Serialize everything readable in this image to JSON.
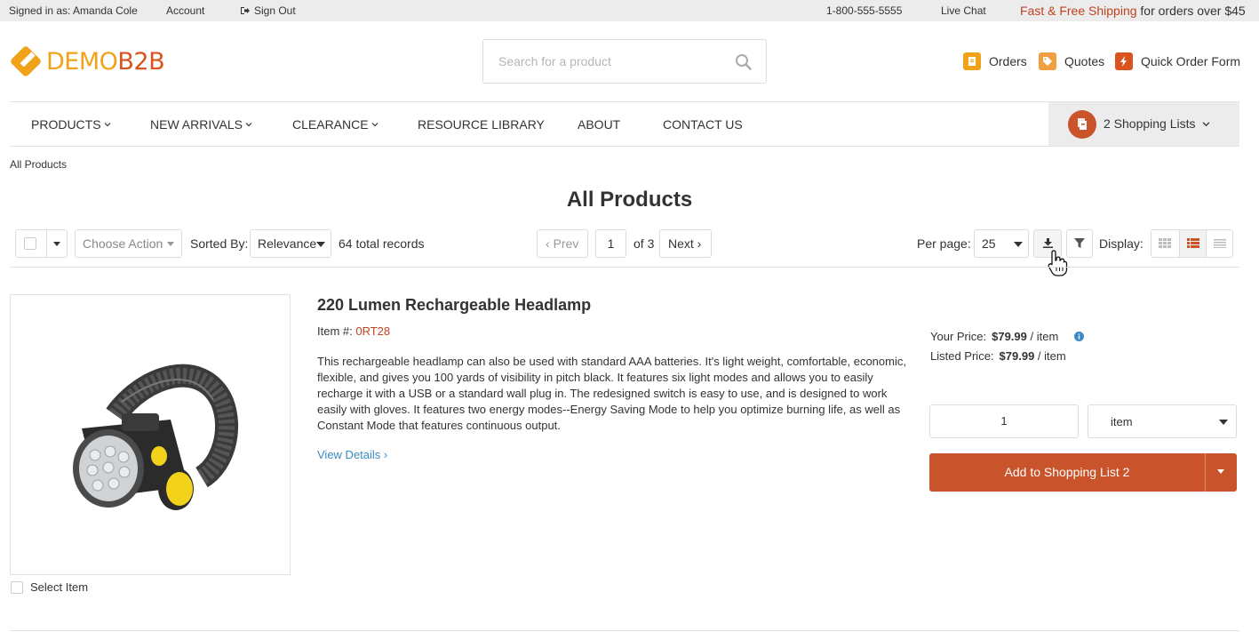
{
  "topbar": {
    "signed_in": "Signed in as: Amanda Cole",
    "account": "Account",
    "sign_out": "Sign Out",
    "phone": "1-800-555-5555",
    "live_chat": "Live Chat",
    "promo_highlight": "Fast & Free Shipping",
    "promo_rest": " for orders over $45"
  },
  "header": {
    "logo_text_1": "DEMO",
    "logo_text_2": "B2B",
    "search_placeholder": "Search for a product",
    "orders": "Orders",
    "quotes": "Quotes",
    "quick_order": "Quick Order Form"
  },
  "nav": {
    "items": [
      "PRODUCTS",
      "NEW ARRIVALS",
      "CLEARANCE",
      "RESOURCE LIBRARY",
      "ABOUT",
      "CONTACT US"
    ],
    "shopping_lists": "2 Shopping Lists",
    "shopping_lists_count": "2"
  },
  "breadcrumb": "All Products",
  "page_title": "All Products",
  "toolbar": {
    "choose_action": "Choose Action",
    "sorted_by_label": "Sorted By:",
    "sort_value": "Relevance",
    "total_records": "64 total records",
    "prev": "Prev",
    "page": "1",
    "of_pages": "of 3",
    "next": "Next",
    "per_page_label": "Per page:",
    "per_page_value": "25",
    "display_label": "Display:"
  },
  "product": {
    "title": "220 Lumen Rechargeable Headlamp",
    "item_label": "Item #: ",
    "item_code": "0RT28",
    "description": "This rechargeable headlamp can also be used with standard AAA batteries. It's light weight, comfortable, economic, flexible, and gives you 100 yards of visibility in pitch black. It features six light modes and allows you to easily recharge it with a USB or a standard wall plug in. The redesigned switch is easy to use, and is designed to work easily with gloves. It features two energy modes--Energy Saving Mode to help you optimize burning life, as well as Constant Mode that features continuous output.",
    "view_details": "View Details",
    "your_price_label": "Your Price:",
    "your_price": "$79.99",
    "listed_price_label": "Listed Price:",
    "listed_price": "$79.99",
    "per_unit": " / item",
    "quantity": "1",
    "unit": "item",
    "add_button": "Add to Shopping List 2",
    "select_item": "Select Item"
  },
  "colors": {
    "accent": "#c9532a",
    "logo": "#f0a319",
    "link": "#3a8bc4"
  }
}
